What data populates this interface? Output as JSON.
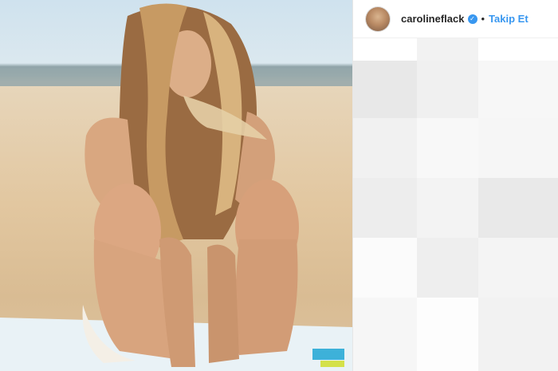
{
  "post": {
    "photo_alt_subject": "woman-sitting-on-beach",
    "header": {
      "username": "carolineflack",
      "verified_icon": "verified-badge-icon",
      "separator": "•",
      "follow_label": "Takip Et"
    }
  },
  "colors": {
    "link_blue": "#3897f0",
    "text_dark": "#262626",
    "border": "#efefef"
  }
}
